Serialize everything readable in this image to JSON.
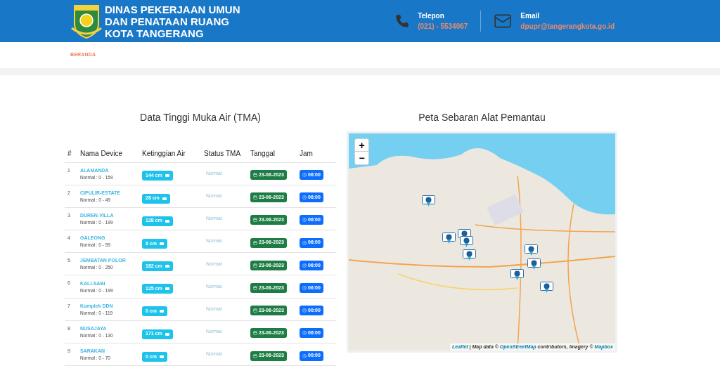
{
  "header": {
    "title_lines": [
      "DINAS PEKERJAAN UMUN",
      "DAN PENATAAN RUANG",
      "KOTA TANGERANG"
    ],
    "contacts": [
      {
        "kind": "phone",
        "label": "Telepon",
        "value": "(021) - 5534067"
      },
      {
        "kind": "email",
        "label": "Email",
        "value": "dpupr@tangerangkota.go.id"
      }
    ]
  },
  "nav": [
    {
      "label": "BERANDA",
      "selected": true
    }
  ],
  "table": {
    "title": "Data Tinggi Muka Air (TMA)",
    "columns": [
      "#",
      "Nama Device",
      "Ketinggian Air",
      "Status TMA",
      "Tanggal",
      "Jam"
    ],
    "rows": [
      {
        "no": "1",
        "name": "ALAMANDA",
        "range": "Normal : 0 - 159",
        "level": "144 cm",
        "status": "Normal",
        "date": "23-06-2023",
        "time": "06:00"
      },
      {
        "no": "2",
        "name": "CIPULIR-ESTATE",
        "range": "Normal : 0 - 49",
        "level": "28 cm",
        "status": "Normal",
        "date": "23-06-2023",
        "time": "06:00"
      },
      {
        "no": "3",
        "name": "DUREN-VILLA",
        "range": "Normal : 0 - 199",
        "level": "128 cm",
        "status": "Normal",
        "date": "23-06-2023",
        "time": "06:00"
      },
      {
        "no": "4",
        "name": "GALEONG",
        "range": "Normal : 0 - 59",
        "level": "8 cm",
        "status": "Normal",
        "date": "23-06-2023",
        "time": "06:00"
      },
      {
        "no": "5",
        "name": "JEMBATAN POLOR",
        "range": "Normal : 0 - 250",
        "level": "182 cm",
        "status": "Normal",
        "date": "23-06-2023",
        "time": "06:00"
      },
      {
        "no": "6",
        "name": "KALI-SABI",
        "range": "Normal : 0 - 199",
        "level": "125 cm",
        "status": "Normal",
        "date": "23-06-2023",
        "time": "06:00"
      },
      {
        "no": "7",
        "name": "Komplek DDN",
        "range": "Normal : 0 - 119",
        "level": "0 cm",
        "status": "Normal",
        "date": "23-06-2023",
        "time": "00:00"
      },
      {
        "no": "8",
        "name": "NUSAJAYA",
        "range": "Normal : 0 - 130",
        "level": "171 cm",
        "status": "Normal",
        "date": "23-06-2023",
        "time": "06:00"
      },
      {
        "no": "9",
        "name": "SARAKAN",
        "range": "Normal : 0 - 70",
        "level": "0 cm",
        "status": "Normal",
        "date": "23-06-2023",
        "time": "00:00"
      }
    ]
  },
  "map": {
    "title": "Peta Sebaran Alat Pemantau",
    "zoom_in": "+",
    "zoom_out": "−",
    "attribution": {
      "lead": "Leaflet",
      "sep": " | Map data © ",
      "osm": "OpenStreetMap",
      "mid": " contributors, Imagery © ",
      "tiles": "Mapbox"
    }
  }
}
